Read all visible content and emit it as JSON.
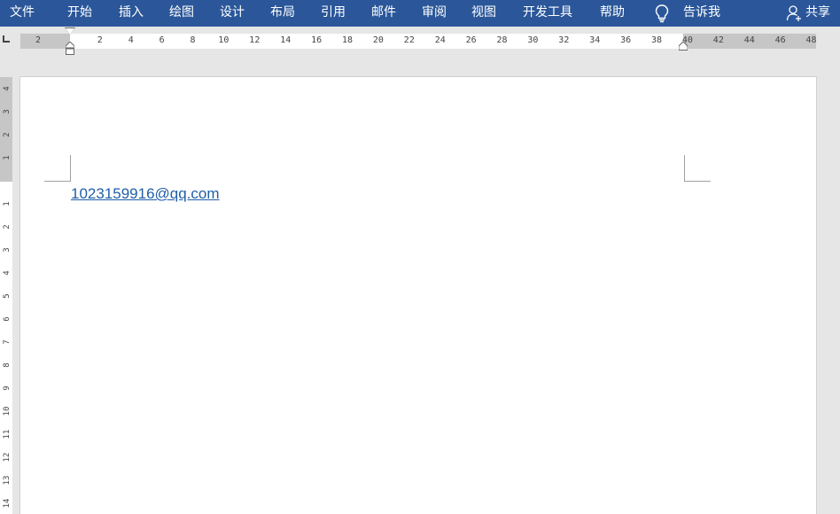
{
  "ribbon": {
    "tabs": [
      "文件",
      "开始",
      "插入",
      "绘图",
      "设计",
      "布局",
      "引用",
      "邮件",
      "审阅",
      "视图",
      "开发工具",
      "帮助"
    ],
    "tell_me": "告诉我",
    "share": "共享",
    "bg_color": "#2b579a"
  },
  "hruler": {
    "labels": [
      "2",
      "",
      "2",
      "4",
      "6",
      "8",
      "10",
      "12",
      "14",
      "16",
      "18",
      "20",
      "22",
      "24",
      "26",
      "28",
      "30",
      "32",
      "34",
      "36",
      "38",
      "40",
      "42",
      "44",
      "46",
      "48"
    ]
  },
  "vruler": {
    "labels": [
      "4",
      "3",
      "2",
      "1",
      "",
      "1",
      "2",
      "3",
      "4",
      "5",
      "6",
      "7",
      "8",
      "9",
      "10",
      "11",
      "12",
      "13",
      "14"
    ]
  },
  "document": {
    "email_link": "1023159916@qq.com",
    "link_color": "#1f5ea8"
  }
}
